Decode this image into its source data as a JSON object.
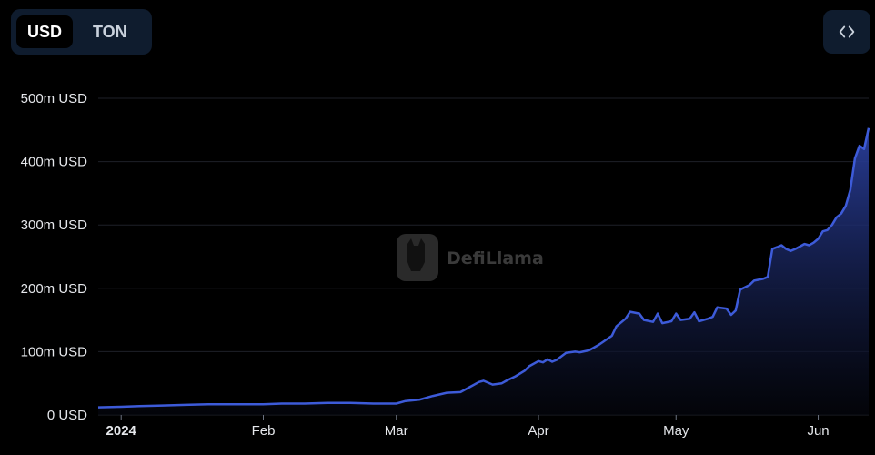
{
  "toggle": {
    "usd_label": "USD",
    "ton_label": "TON",
    "active": "USD"
  },
  "embed_icon": "code-brackets-icon",
  "watermark": {
    "text": "DefiLlama",
    "icon": "llama-logo-icon"
  },
  "colors": {
    "line": "#3d5bd9",
    "area_top": "#2a3f9e",
    "area_bottom": "#05070f",
    "grid": "#1e2128",
    "panel": "#0f1c2e"
  },
  "chart_data": {
    "type": "area",
    "title": "",
    "xlabel": "",
    "ylabel": "",
    "ylim": [
      0,
      500
    ],
    "y_unit": "m USD",
    "y_ticks": [
      {
        "value": 0,
        "label": "0 USD"
      },
      {
        "value": 100,
        "label": "100m USD"
      },
      {
        "value": 200,
        "label": "200m USD"
      },
      {
        "value": 300,
        "label": "300m USD"
      },
      {
        "value": 400,
        "label": "400m USD"
      },
      {
        "value": 500,
        "label": "500m USD"
      }
    ],
    "x_range": [
      "2023-12-27",
      "2024-06-12"
    ],
    "x_ticks": [
      {
        "date": "2024-01-01",
        "label": "2024",
        "bold": true
      },
      {
        "date": "2024-02-01",
        "label": "Feb",
        "bold": false
      },
      {
        "date": "2024-03-01",
        "label": "Mar",
        "bold": false
      },
      {
        "date": "2024-04-01",
        "label": "Apr",
        "bold": false
      },
      {
        "date": "2024-05-01",
        "label": "May",
        "bold": false
      },
      {
        "date": "2024-06-01",
        "label": "Jun",
        "bold": false
      }
    ],
    "grid": true,
    "series": [
      {
        "points": [
          [
            "2023-12-27",
            12
          ],
          [
            "2024-01-01",
            13
          ],
          [
            "2024-01-05",
            14
          ],
          [
            "2024-01-10",
            15
          ],
          [
            "2024-01-15",
            16
          ],
          [
            "2024-01-20",
            17
          ],
          [
            "2024-01-25",
            17
          ],
          [
            "2024-02-01",
            17
          ],
          [
            "2024-02-05",
            18
          ],
          [
            "2024-02-10",
            18
          ],
          [
            "2024-02-15",
            19
          ],
          [
            "2024-02-20",
            19
          ],
          [
            "2024-02-25",
            18
          ],
          [
            "2024-03-01",
            18
          ],
          [
            "2024-03-03",
            22
          ],
          [
            "2024-03-06",
            24
          ],
          [
            "2024-03-09",
            30
          ],
          [
            "2024-03-12",
            35
          ],
          [
            "2024-03-15",
            36
          ],
          [
            "2024-03-17",
            44
          ],
          [
            "2024-03-19",
            52
          ],
          [
            "2024-03-20",
            54
          ],
          [
            "2024-03-22",
            48
          ],
          [
            "2024-03-24",
            50
          ],
          [
            "2024-03-25",
            54
          ],
          [
            "2024-03-27",
            61
          ],
          [
            "2024-03-29",
            70
          ],
          [
            "2024-03-30",
            77
          ],
          [
            "2024-04-01",
            85
          ],
          [
            "2024-04-02",
            83
          ],
          [
            "2024-04-03",
            88
          ],
          [
            "2024-04-04",
            84
          ],
          [
            "2024-04-05",
            87
          ],
          [
            "2024-04-07",
            98
          ],
          [
            "2024-04-09",
            100
          ],
          [
            "2024-04-10",
            99
          ],
          [
            "2024-04-12",
            102
          ],
          [
            "2024-04-14",
            110
          ],
          [
            "2024-04-15",
            115
          ],
          [
            "2024-04-17",
            125
          ],
          [
            "2024-04-18",
            140
          ],
          [
            "2024-04-20",
            152
          ],
          [
            "2024-04-21",
            163
          ],
          [
            "2024-04-23",
            160
          ],
          [
            "2024-04-24",
            150
          ],
          [
            "2024-04-26",
            147
          ],
          [
            "2024-04-27",
            160
          ],
          [
            "2024-04-28",
            145
          ],
          [
            "2024-04-30",
            148
          ],
          [
            "2024-05-01",
            160
          ],
          [
            "2024-05-02",
            150
          ],
          [
            "2024-05-04",
            152
          ],
          [
            "2024-05-05",
            162
          ],
          [
            "2024-05-06",
            148
          ],
          [
            "2024-05-08",
            152
          ],
          [
            "2024-05-09",
            155
          ],
          [
            "2024-05-10",
            170
          ],
          [
            "2024-05-12",
            168
          ],
          [
            "2024-05-13",
            158
          ],
          [
            "2024-05-14",
            165
          ],
          [
            "2024-05-15",
            198
          ],
          [
            "2024-05-17",
            205
          ],
          [
            "2024-05-18",
            212
          ],
          [
            "2024-05-20",
            215
          ],
          [
            "2024-05-21",
            218
          ],
          [
            "2024-05-22",
            262
          ],
          [
            "2024-05-23",
            265
          ],
          [
            "2024-05-24",
            268
          ],
          [
            "2024-05-25",
            262
          ],
          [
            "2024-05-26",
            259
          ],
          [
            "2024-05-27",
            262
          ],
          [
            "2024-05-28",
            266
          ],
          [
            "2024-05-29",
            270
          ],
          [
            "2024-05-30",
            268
          ],
          [
            "2024-05-31",
            272
          ],
          [
            "2024-06-01",
            278
          ],
          [
            "2024-06-02",
            290
          ],
          [
            "2024-06-03",
            292
          ],
          [
            "2024-06-04",
            300
          ],
          [
            "2024-06-05",
            312
          ],
          [
            "2024-06-06",
            318
          ],
          [
            "2024-06-07",
            330
          ],
          [
            "2024-06-08",
            355
          ],
          [
            "2024-06-09",
            405
          ],
          [
            "2024-06-10",
            425
          ],
          [
            "2024-06-11",
            420
          ],
          [
            "2024-06-12",
            453
          ]
        ]
      }
    ]
  }
}
